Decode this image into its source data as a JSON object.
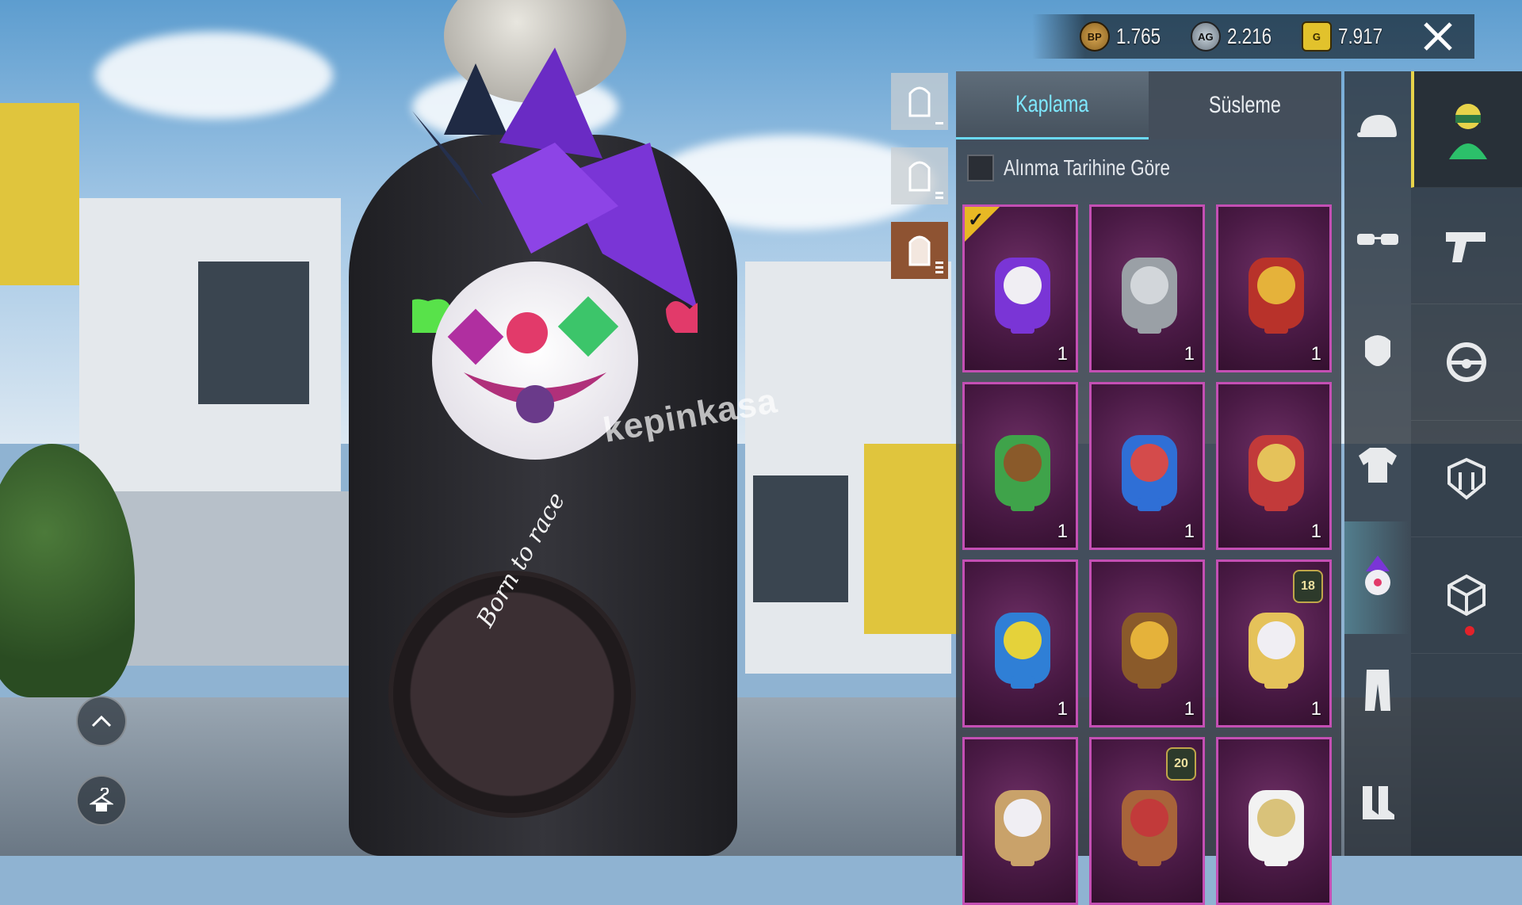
{
  "currency": [
    {
      "icon": "bp-coin-icon",
      "badge": "BP",
      "value": "1.765"
    },
    {
      "icon": "ag-coin-icon",
      "badge": "AG",
      "value": "2.216"
    },
    {
      "icon": "uc-coin-icon",
      "badge": "G",
      "value": "7.917"
    }
  ],
  "tabs": [
    {
      "label": "Kaplama",
      "active": true
    },
    {
      "label": "Süsleme",
      "active": false
    }
  ],
  "sort": {
    "label": "Alınma Tarihine Göre",
    "checked": false
  },
  "items": [
    {
      "name": "jester-backpack",
      "count": "1",
      "equipped": true
    },
    {
      "name": "silver-scale-backpack",
      "count": "1"
    },
    {
      "name": "golden-dragon-backpack",
      "count": "1"
    },
    {
      "name": "cactus-backpack",
      "count": "1"
    },
    {
      "name": "robot-tv-backpack",
      "count": "1"
    },
    {
      "name": "lantern-backpack",
      "count": "1"
    },
    {
      "name": "pixel-monster-backpack",
      "count": "1"
    },
    {
      "name": "treasure-chest-backpack",
      "count": "1"
    },
    {
      "name": "king-skull-backpack",
      "count": "1",
      "level": "18"
    },
    {
      "name": "tiger-backpack",
      "count": ""
    },
    {
      "name": "bear-backpack",
      "count": "",
      "level": "20"
    },
    {
      "name": "white-gold-backpack",
      "count": ""
    }
  ],
  "watermark": "kepinkasa",
  "pan_text": "Born to race",
  "colors": {
    "accent": "#6ad9f3",
    "card_border": "#c44fb4",
    "card_bg": "#4a1a45",
    "equipped": "#e8b924"
  }
}
